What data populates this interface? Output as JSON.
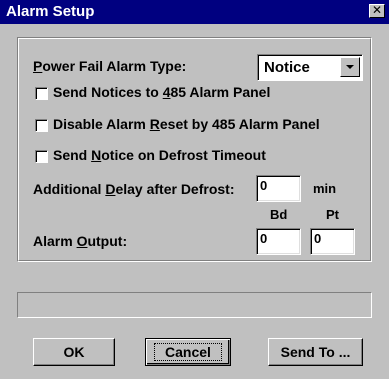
{
  "window": {
    "title": "Alarm Setup",
    "close_glyph": "✕"
  },
  "power_fail": {
    "label": "Power Fail Alarm Type:",
    "value": "Notice"
  },
  "checkboxes": [
    {
      "label": "Send Notices to 485 Alarm Panel",
      "checked": false
    },
    {
      "label": "Disable Alarm Reset by 485 Alarm Panel",
      "checked": false
    },
    {
      "label": "Send Notice on Defrost Timeout",
      "checked": false
    }
  ],
  "delay": {
    "label": "Additional Delay after Defrost:",
    "value": "0",
    "unit": "min"
  },
  "alarm_output": {
    "label": "Alarm Output:",
    "bd_header": "Bd",
    "pt_header": "Pt",
    "bd_value": "0",
    "pt_value": "0"
  },
  "status_text": "",
  "buttons": {
    "ok": "OK",
    "cancel": "Cancel",
    "send_to": "Send To ..."
  }
}
